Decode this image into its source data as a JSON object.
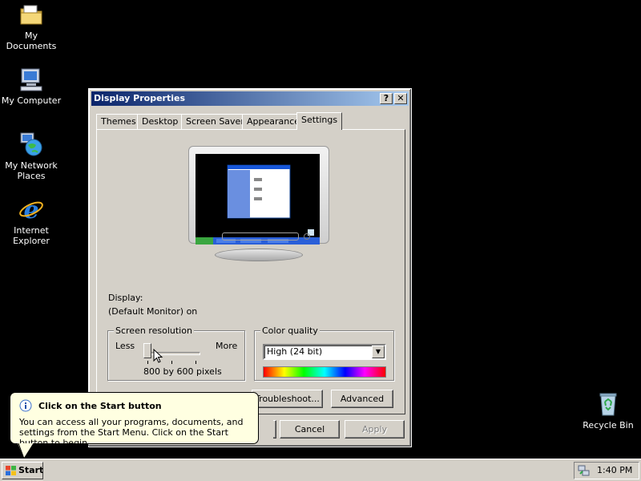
{
  "desktop": {
    "icons": [
      {
        "label": "My Documents"
      },
      {
        "label": "My Computer"
      },
      {
        "label": "My Network Places"
      },
      {
        "label": "Internet Explorer"
      },
      {
        "label": "Recycle Bin"
      }
    ]
  },
  "dialog": {
    "title": "Display Properties",
    "help_btn": "?",
    "close_btn": "✕",
    "tabs": [
      "Themes",
      "Desktop",
      "Screen Saver",
      "Appearance",
      "Settings"
    ],
    "active_tab": "Settings",
    "display_label": "Display:",
    "display_value": "(Default Monitor) on",
    "resolution": {
      "title": "Screen resolution",
      "less": "Less",
      "more": "More",
      "value": "800 by 600 pixels",
      "slider_position": 0
    },
    "color_quality": {
      "title": "Color quality",
      "selected": "High (24 bit)"
    },
    "buttons": {
      "troubleshoot": "Troubleshoot...",
      "advanced": "Advanced",
      "cancel": "Cancel",
      "apply": "Apply"
    }
  },
  "balloon": {
    "title": "Click on the Start button",
    "body": "You can access all your programs, documents, and settings from the Start Menu. Click on the Start button to begin."
  },
  "taskbar": {
    "start_label": "Start",
    "clock": "1:40 PM"
  },
  "colors": {
    "title_gradient_start": "#0a246a",
    "title_gradient_end": "#a6caf0",
    "balloon_bg": "#ffffe1",
    "face": "#d4d0c8"
  }
}
